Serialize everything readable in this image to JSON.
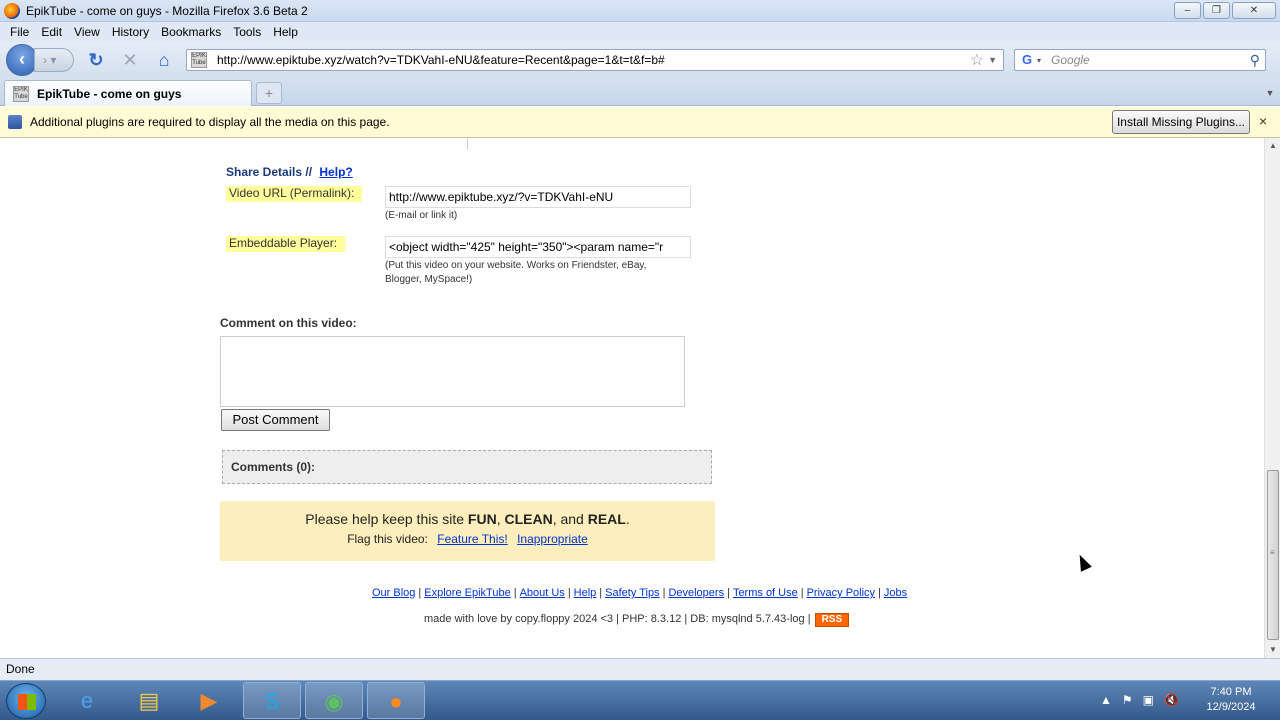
{
  "window": {
    "title": "EpikTube - come on guys - Mozilla Firefox 3.6 Beta 2"
  },
  "menu": [
    "File",
    "Edit",
    "View",
    "History",
    "Bookmarks",
    "Tools",
    "Help"
  ],
  "nav": {
    "url": "http://www.epiktube.xyz/watch?v=TDKVahI-eNU&feature=Recent&page=1&t=t&f=b#",
    "search_placeholder": "Google",
    "favicon_text": "EPIK Tube"
  },
  "tab": {
    "label": "EpikTube - come on guys",
    "newtab": "+"
  },
  "notification": {
    "message": "Additional plugins are required to display all the media on this page.",
    "install_button": "Install Missing Plugins...",
    "close": "×"
  },
  "share": {
    "title": "Share Details //",
    "help_link": "Help?",
    "url_label": "Video URL (Permalink):",
    "url_value": "http://www.epiktube.xyz/?v=TDKVahI-eNU",
    "url_hint": "(E-mail or link it)",
    "embed_label": "Embeddable Player:",
    "embed_value": "<object width=\"425\" height=\"350\"><param name=\"r",
    "embed_hint_1": "(Put this video on your website. Works on Friendster, eBay,",
    "embed_hint_2": "Blogger, MySpace!)"
  },
  "comment": {
    "label": "Comment on this video:",
    "post_button": "Post Comment",
    "count_label": "Comments (0):"
  },
  "flag": {
    "line1_prefix": "Please help keep this site",
    "word1": "FUN",
    "sep1": ",",
    "word2": "CLEAN",
    "sep2": ", and",
    "word3": "REAL",
    "end": ".",
    "line2_label": "Flag this video:",
    "feature_link": "Feature This!",
    "inappropriate_link": "Inappropriate"
  },
  "footer": {
    "links": [
      "Our Blog",
      "Explore EpikTube",
      "About Us",
      "Help",
      "Safety Tips",
      "Developers",
      "Terms of Use",
      "Privacy Policy",
      "Jobs"
    ],
    "made": "made with love by copy.floppy 2024 <3 | PHP: 8.3.12 | DB: mysqlnd 5.7.43-log |",
    "rss": "RSS"
  },
  "status": {
    "text": "Done"
  },
  "taskbar": {
    "apps": [
      "internet-explorer",
      "windows-explorer",
      "media-player",
      "skype",
      "chrome",
      "firefox"
    ],
    "time": "7:40 PM",
    "date": "12/9/2024"
  }
}
